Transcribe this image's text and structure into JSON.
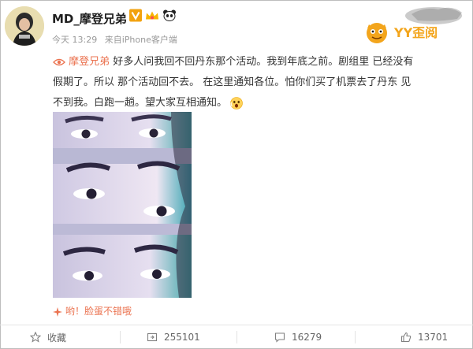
{
  "user": {
    "name": "MD_摩登兄弟"
  },
  "meta": {
    "time": "今天 13:29",
    "source_prefix": "来自",
    "source": "iPhone客户端"
  },
  "watermark": {
    "text": "YY歪阅"
  },
  "post": {
    "mention": "摩登兄弟",
    "line1": "好多人问我回不回丹东那个活动。我到年底之前。剧组里 已经没有",
    "line2": "假期了。所以 那个活动回不去。 在这里通知各位。怕你们买了机票去了丹东 见",
    "line3": "不到我。白跑一趟。望大家互相通知。"
  },
  "photo_caption": "哟！脸蛋不错哦",
  "actions": {
    "favorite": "收藏",
    "repost": "255101",
    "comment": "16279",
    "like": "13701"
  },
  "colors": {
    "accent": "#eb7350",
    "verified": "#f2a20f",
    "text": "#333333",
    "meta": "#999999"
  }
}
